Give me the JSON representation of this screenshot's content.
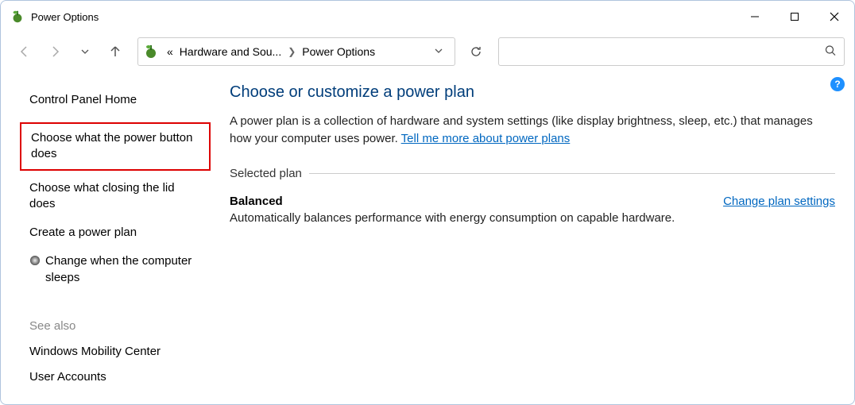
{
  "window": {
    "title": "Power Options"
  },
  "breadcrumb": {
    "back_chevrons": "«",
    "parent": "Hardware and Sou...",
    "current": "Power Options"
  },
  "search": {
    "placeholder": ""
  },
  "sidebar": {
    "home": "Control Panel Home",
    "links": {
      "power_button": "Choose what the power button does",
      "close_lid": "Choose what closing the lid does",
      "create_plan": "Create a power plan",
      "sleep": "Change when the computer sleeps"
    },
    "see_also_label": "See also",
    "see_also": {
      "mobility": "Windows Mobility Center",
      "accounts": "User Accounts"
    }
  },
  "main": {
    "title": "Choose or customize a power plan",
    "desc_pre": "A power plan is a collection of hardware and system settings (like display brightness, sleep, etc.) that manages how your computer uses power. ",
    "desc_link": "Tell me more about power plans",
    "section": "Selected plan",
    "plan": {
      "name": "Balanced",
      "change_link": "Change plan settings",
      "desc": "Automatically balances performance with energy consumption on capable hardware."
    }
  },
  "help_tooltip": "?"
}
